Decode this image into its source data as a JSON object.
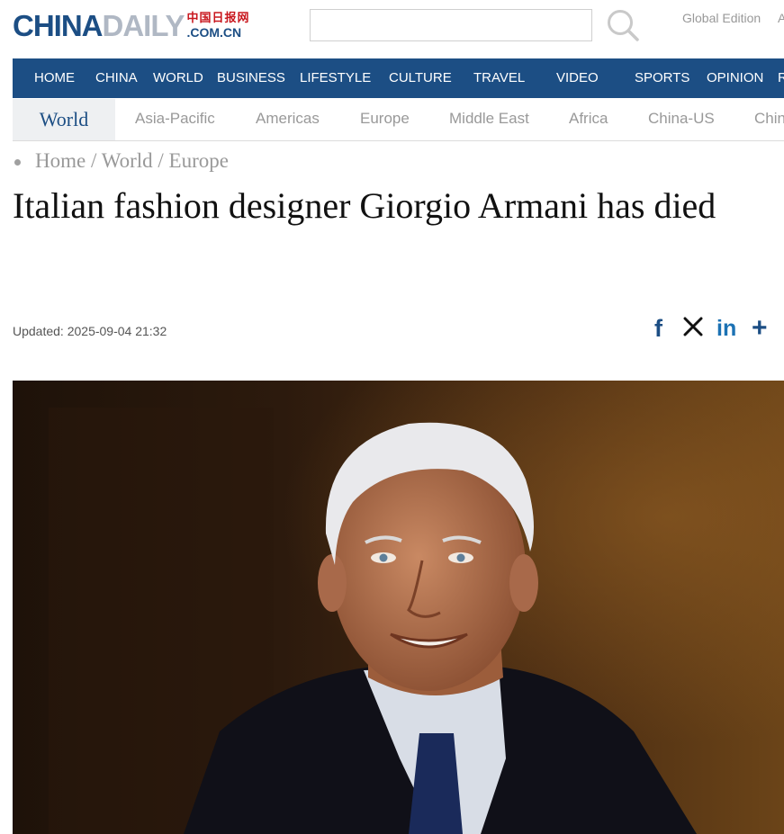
{
  "header": {
    "logo_china": "CHINA",
    "logo_daily": "DAILY",
    "logo_cn": "中国日报网",
    "logo_domain": ".COM.CN",
    "search_placeholder": "",
    "edition": "Global Edition",
    "edition_cut": "A"
  },
  "nav": {
    "items": [
      "HOME",
      "CHINA",
      "WORLD",
      "BUSINESS",
      "LIFESTYLE",
      "CULTURE",
      "TRAVEL",
      "VIDEO",
      "SPORTS",
      "OPINION",
      "R"
    ]
  },
  "subnav": {
    "active": "World",
    "items": [
      "Asia-Pacific",
      "Americas",
      "Europe",
      "Middle East",
      "Africa",
      "China-US",
      "Chin"
    ]
  },
  "breadcrumb": {
    "home": "Home",
    "sep1": "/",
    "section": "World",
    "sep2": "/",
    "subsection": "Europe"
  },
  "article": {
    "headline": "Italian fashion designer Giorgio Armani has died",
    "updated": "Updated: 2025-09-04 21:32"
  },
  "share": {
    "facebook": "f",
    "twitter": "𝕏",
    "linkedin": "in",
    "more": "+"
  },
  "colors": {
    "brand_blue": "#1c4e84",
    "logo_grey": "#b0b8c4",
    "logo_red": "#c8161d"
  }
}
